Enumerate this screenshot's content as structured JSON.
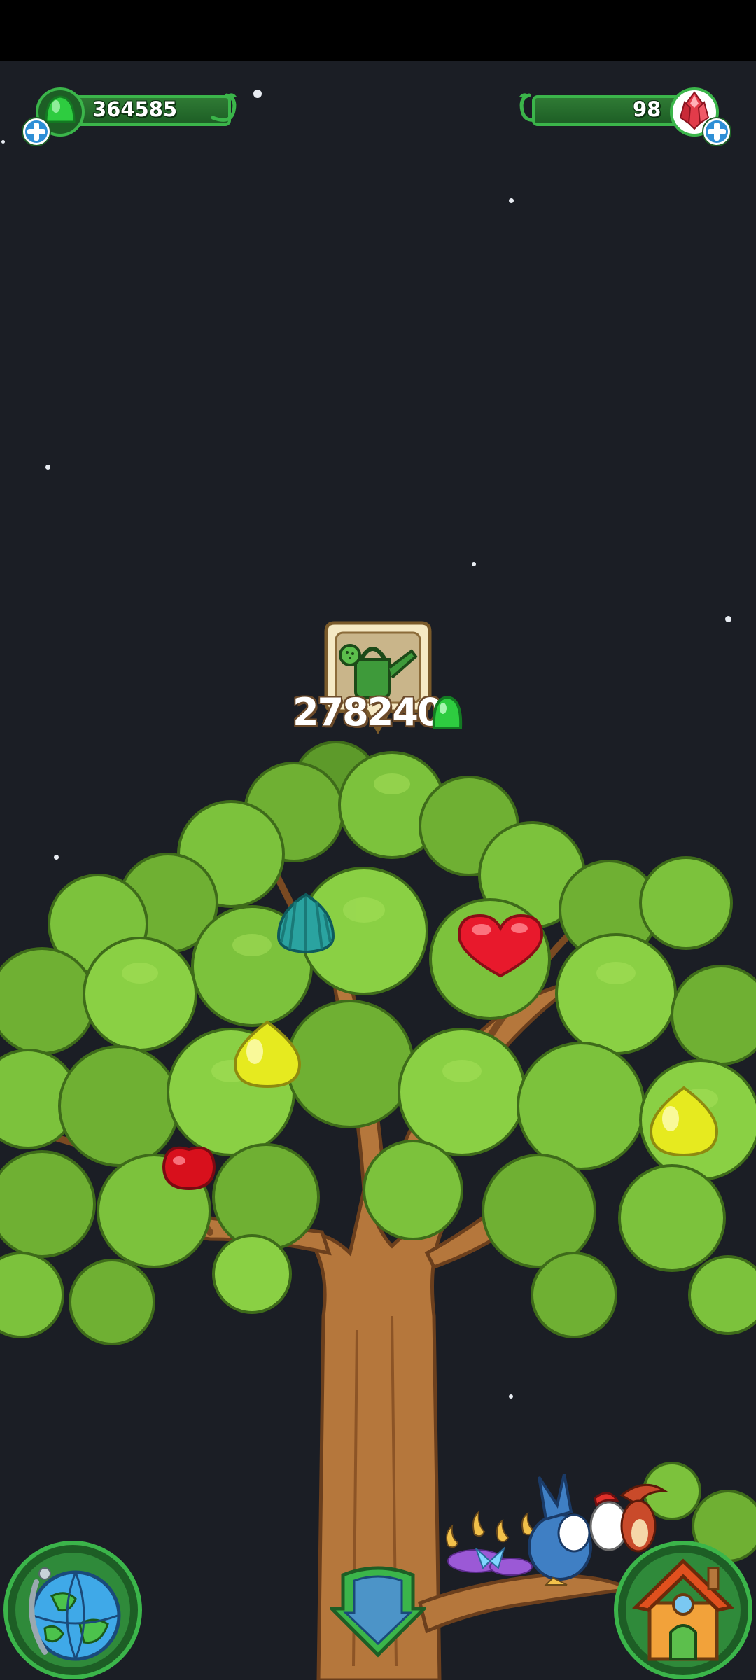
{
  "resources": {
    "gum": {
      "value": "364585",
      "icon": "green-gumdrop-icon",
      "color": "#2ecc40"
    },
    "gems": {
      "value": "98",
      "icon": "red-crystal-icon",
      "color": "#e23b4a"
    }
  },
  "reward": {
    "amount": "278240",
    "icon": "watering-can-icon",
    "currency_icon": "green-gumdrop-icon"
  },
  "tree_fruits": [
    {
      "type": "teal-shell-fruit",
      "color": "#2aa3a0"
    },
    {
      "type": "red-heart-fruit",
      "color": "#e8192c"
    },
    {
      "type": "yellow-drop-fruit",
      "color": "#e6ea1f"
    },
    {
      "type": "red-apple-fruit",
      "color": "#d8101c"
    },
    {
      "type": "yellow-drop-fruit",
      "color": "#e6ea1f"
    }
  ],
  "nav": {
    "left": "globe-icon",
    "center": "down-arrow-icon",
    "right": "house-icon"
  }
}
